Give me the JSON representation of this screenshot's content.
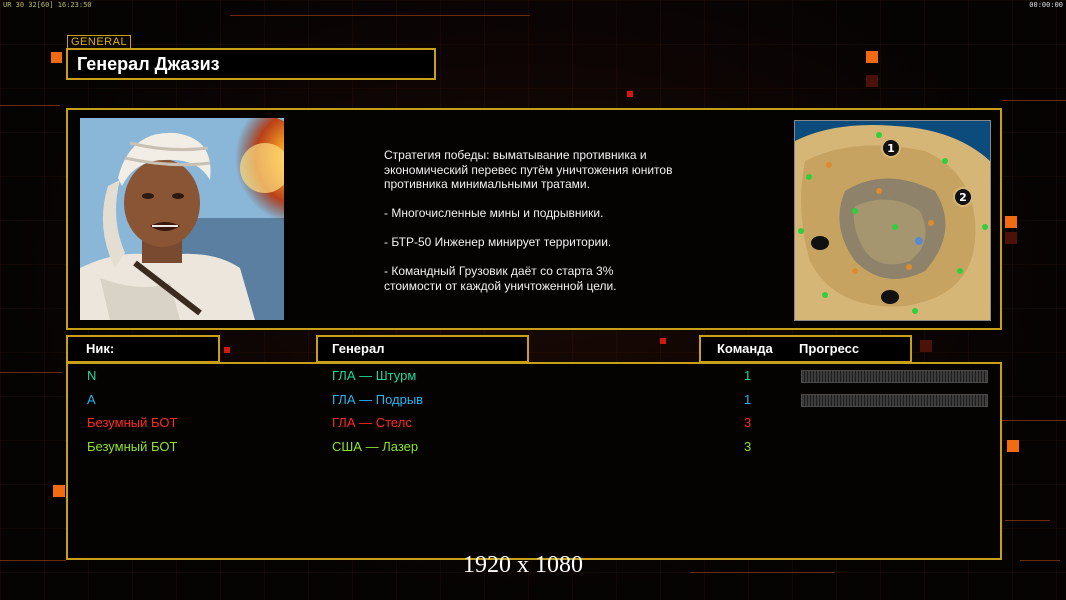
{
  "hud": {
    "left": "UR 30 32[60] 16:23:50",
    "right": "00:00:00"
  },
  "general_tag": "GENERAL",
  "general_name": "Генерал Джазиз",
  "description": [
    "Стратегия победы: выматывание противника и\n экономический перевес путём уничтожения юнитов\n противника минимальными тратами.",
    "- Многочисленные мины и подрывники.",
    "- БТР-50 Инженер минирует территории.",
    "- Командный Грузовик даёт со старта 3%\n стоимости от каждой уничтоженной цели."
  ],
  "headers": {
    "nick": "Ник:",
    "general": "Генерал",
    "team": "Команда",
    "progress": "Прогресс"
  },
  "players": [
    {
      "nick": "N",
      "general": "ГЛА — Штурм",
      "team": "1",
      "color": "#1fd7a0",
      "progress_bar": true
    },
    {
      "nick": "A",
      "general": "ГЛА — Подрыв",
      "team": "1",
      "color": "#28b4f0",
      "progress_bar": true
    },
    {
      "nick": "Безумный БОТ",
      "general": "ГЛА — Стелс",
      "team": "3",
      "color": "#ff2a1e",
      "progress_bar": false
    },
    {
      "nick": "Безумный БОТ",
      "general": "США — Лазер",
      "team": "3",
      "color": "#8ee22a",
      "progress_bar": false
    }
  ],
  "minimap": {
    "start_markers": [
      "1",
      "2"
    ]
  },
  "resolution_label": "1920 x 1080",
  "colors": {
    "frame": "#c8a018",
    "accent_orange": "#f26a12"
  }
}
